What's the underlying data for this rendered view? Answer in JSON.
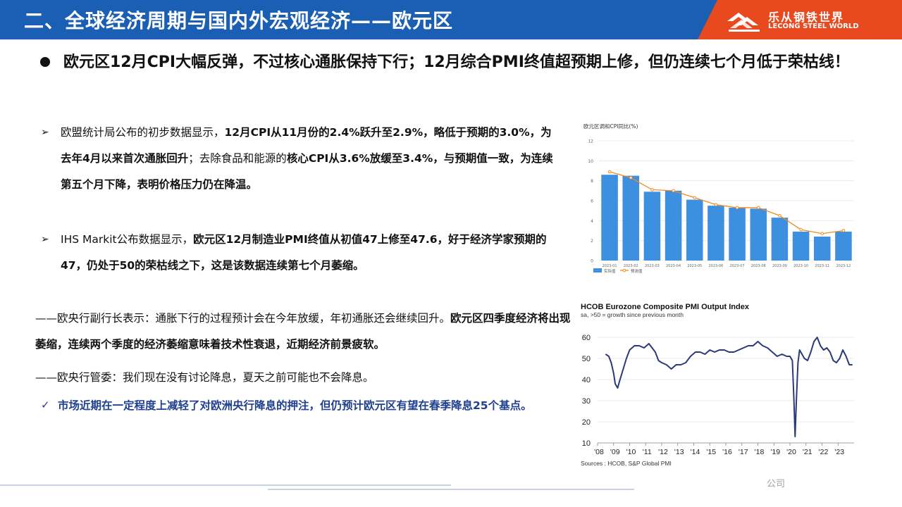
{
  "header": {
    "title": "二、全球经济周期与国内外宏观经济——欧元区",
    "logo_cn": "乐从钢铁世界",
    "logo_en": "LECONG STEEL WORLD",
    "accent": "#1a5fb4",
    "logo_bg": "#e8491f"
  },
  "headline": "欧元区12月CPI大幅反弹，不过核心通胀保持下行；12月综合PMI终值超预期上修，但仍连续七个月低于荣枯线！",
  "sections": {
    "p1": {
      "a": "欧盟统计局公布的初步数据显示，",
      "b": "12月CPI从11月份的2.4%跃升至2.9%，略低于预期的3.0%，为去年4月以来首次通胀回升",
      "c": "；去除食品和能源的",
      "d": "核心CPI从3.6%放缓至3.4%，与预期值一致，为连续第五个月下降，表明价格压力仍在降温。"
    },
    "p2": {
      "a": "IHS Markit公布数据显示，",
      "b": "欧元区12月制造业PMI终值从初值47上修至47.6，好于经济学家预期的47，仍处于50的荣枯线之下，这是该数据连续第七个月萎缩。"
    },
    "p3": {
      "a": "——欧央行副行长表示：通胀下行的过程预计会在今年放缓，年初通胀还会继续回升。",
      "b": "欧元区四季度经济将出现萎缩，连续两个季度的经济萎缩意味着技术性衰退，近期经济前景疲软。"
    },
    "p4": "——欧央行管委：我们现在没有讨论降息，夏天之前可能也不会降息。",
    "conclusion": "市场近期在一定程度上减轻了对欧洲央行降息的押注，但仍预计欧元区有望在春季降息25个基点。",
    "conclusion_color": "#1f3f8f"
  },
  "footer_text": "公司",
  "chart_data": [
    {
      "type": "bar",
      "title": "欧元区调和CPI同比(%)",
      "categories": [
        "2023-01",
        "2023-02",
        "2023-03",
        "2023-04",
        "2023-05",
        "2023-06",
        "2023-07",
        "2023-08",
        "2023-09",
        "2023-10",
        "2023-11",
        "2023-12"
      ],
      "series": [
        {
          "name": "实际值",
          "type": "bar",
          "color": "#3d8fe0",
          "values": [
            8.6,
            8.5,
            6.9,
            7.0,
            6.1,
            5.5,
            5.3,
            5.2,
            4.3,
            2.9,
            2.4,
            2.9
          ]
        },
        {
          "name": "预测值",
          "type": "line",
          "color": "#f08a24",
          "values": [
            8.9,
            8.3,
            7.1,
            7.0,
            6.3,
            5.6,
            5.3,
            5.3,
            4.5,
            3.1,
            2.7,
            3.0
          ]
        }
      ],
      "yticks": [
        0,
        2,
        4,
        6,
        8,
        10,
        12
      ],
      "ylim": [
        0,
        12
      ],
      "legend": "bottom-left",
      "grid": true
    },
    {
      "type": "line",
      "title": "HCOB Eurozone Composite PMI Output Index",
      "subtitle": "sa, >50 = growth  since previous month",
      "source": "Sources : HCOB, S&P Global PMI",
      "ylim": [
        10,
        65
      ],
      "yticks": [
        10,
        20,
        30,
        40,
        50,
        60
      ],
      "xticks": [
        "'08",
        "'09",
        "'10",
        "'11",
        "'12",
        "'13",
        "'14",
        "'15",
        "'16",
        "'17",
        "'18",
        "'19",
        "'20",
        "'21",
        "'22",
        "'23"
      ],
      "color": "#2b3a78",
      "series": [
        {
          "x": [
            2008.5,
            2008.7,
            2008.85,
            2009.0,
            2009.1,
            2009.25,
            2009.4,
            2009.6,
            2009.8,
            2010.0,
            2010.3,
            2010.6,
            2010.9,
            2011.2,
            2011.4,
            2011.6,
            2011.8,
            2012.0,
            2012.3,
            2012.6,
            2012.9,
            2013.2,
            2013.5,
            2013.8,
            2014.1,
            2014.4,
            2014.7,
            2015.0,
            2015.3,
            2015.6,
            2015.9,
            2016.2,
            2016.5,
            2016.8,
            2017.1,
            2017.4,
            2017.7,
            2018.0,
            2018.3,
            2018.6,
            2018.9,
            2019.2,
            2019.5,
            2019.8,
            2020.0,
            2020.15,
            2020.25,
            2020.32,
            2020.4,
            2020.5,
            2020.6,
            2020.75,
            2020.9,
            2021.1,
            2021.3,
            2021.5,
            2021.7,
            2021.9,
            2022.1,
            2022.3,
            2022.5,
            2022.7,
            2022.9,
            2023.1,
            2023.3,
            2023.5,
            2023.7,
            2023.9
          ],
          "y": [
            52,
            51,
            48,
            43,
            38,
            36,
            40,
            45,
            50,
            54,
            56,
            56,
            55,
            57,
            55,
            53,
            49,
            48,
            47,
            45,
            47,
            47,
            48,
            51,
            53,
            53,
            52,
            54,
            53,
            54,
            54,
            53,
            53,
            54,
            55,
            56,
            56,
            58,
            56,
            55,
            53,
            51,
            52,
            51,
            51,
            49,
            30,
            13,
            30,
            48,
            54,
            52,
            50,
            49,
            53,
            58,
            60,
            56,
            54,
            55,
            53,
            49,
            48,
            50,
            54,
            51,
            47,
            47
          ]
        }
      ]
    }
  ]
}
